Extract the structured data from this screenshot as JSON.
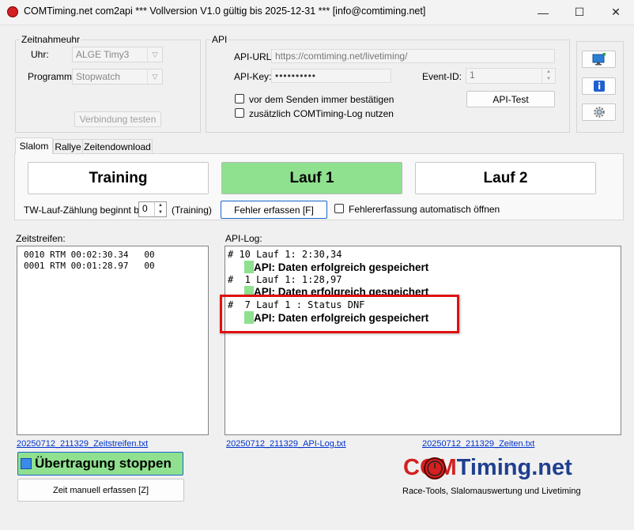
{
  "window": {
    "title": "COMTiming.net com2api *** Vollversion V1.0 gültig bis 2025-12-31 *** [info@comtiming.net]",
    "minimize": "—",
    "maximize": "☐",
    "close": "✕"
  },
  "zeitnahme": {
    "legend": "Zeitnahmeuhr",
    "uhr_label": "Uhr:",
    "uhr_value": "ALGE Timy3",
    "programm_label": "Programm:",
    "programm_value": "Stopwatch",
    "test_button": "Verbindung testen"
  },
  "api": {
    "legend": "API",
    "url_label": "API-URL:",
    "url_value": "https://comtiming.net/livetiming/",
    "key_label": "API-Key:",
    "key_value": "••••••••••",
    "event_label": "Event-ID:",
    "event_value": "1",
    "confirm_label": "vor dem Senden immer bestätigen",
    "log_label": "zusätzlich COMTiming-Log nutzen",
    "test_button": "API-Test"
  },
  "tabs": [
    "Slalom",
    "Rallye",
    "Zeitendownload"
  ],
  "runs": {
    "training": "Training",
    "lauf1": "Lauf 1",
    "lauf2": "Lauf 2",
    "tw_label": "TW-Lauf-Zählung beginnt bei:",
    "tw_value": "0",
    "tw_suffix": "(Training)",
    "fehler_button": "Fehler erfassen [F]",
    "fehler_auto_label": "Fehlererfassung automatisch öffnen"
  },
  "zeitstreifen": {
    "label": "Zeitstreifen:",
    "lines": [
      "0010 RTM 00:02:30.34   00",
      "0001 RTM 00:01:28.97   00"
    ],
    "file_link": "20250712_211329_Zeitstreifen.txt"
  },
  "apilog": {
    "label": "API-Log:",
    "entries": [
      {
        "line": "# 10 Lauf 1: 2:30,34",
        "status": "API: Daten erfolgreich gespeichert"
      },
      {
        "line": "#  1 Lauf 1: 1:28,97",
        "status": "API: Daten erfolgreich gespeichert"
      },
      {
        "line": "#  7 Lauf 1 : Status DNF",
        "status": "API: Daten erfolgreich gespeichert"
      }
    ],
    "file_link": "20250712_211329_API-Log.txt",
    "zeiten_link": "20250712_211329_Zeiten.txt"
  },
  "bottom": {
    "stop_button": "Übertragung stoppen",
    "manual_button": "Zeit manuell erfassen [Z]"
  },
  "logo": {
    "com": "COM",
    "timing": "Timing.net",
    "tagline": "Race-Tools, Slalomauswertung und Livetiming"
  },
  "colors": {
    "active_run": "#8fe08f",
    "highlight_border": "#e01010",
    "logo_red": "#d42020",
    "logo_blue": "#1f3f8f"
  }
}
